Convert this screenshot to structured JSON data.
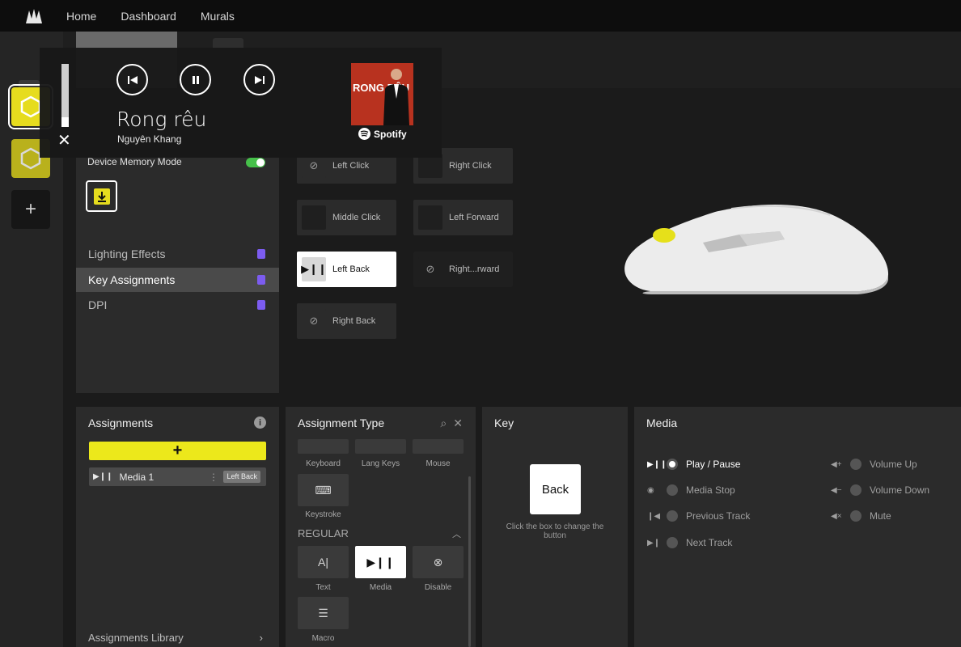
{
  "nav": {
    "home": "Home",
    "dashboard": "Dashboard",
    "murals": "Murals"
  },
  "device_settings": {
    "device_memory_mode_label": "Device Memory Mode",
    "device_memory_mode_on": true,
    "menu": [
      {
        "label": "Lighting Effects",
        "active": false
      },
      {
        "label": "Key Assignments",
        "active": true
      },
      {
        "label": "DPI",
        "active": false
      }
    ]
  },
  "keys": {
    "left_click": "Left Click",
    "right_click": "Right Click",
    "middle_click": "Middle Click",
    "left_forward": "Left Forward",
    "left_back": "Left Back",
    "right_forward": "Right...rward",
    "right_back": "Right Back"
  },
  "assignments": {
    "title": "Assignments",
    "add_label": "+",
    "item_label": "Media 1",
    "item_tag": "Left Back",
    "library": "Assignments Library"
  },
  "assignment_type": {
    "title": "Assignment Type",
    "advanced": [
      {
        "label": "Keyboard"
      },
      {
        "label": "Lang Keys"
      },
      {
        "label": "Mouse"
      },
      {
        "label": "Keystroke"
      }
    ],
    "section": "REGULAR",
    "regular": [
      {
        "label": "Text",
        "selected": false
      },
      {
        "label": "Media",
        "selected": true
      },
      {
        "label": "Disable",
        "selected": false
      },
      {
        "label": "Macro",
        "selected": false
      }
    ]
  },
  "key_panel": {
    "title": "Key",
    "key_value": "Back",
    "hint": "Click the box to change the button"
  },
  "media_panel": {
    "title": "Media",
    "options_left": [
      {
        "label": "Play / Pause",
        "selected": true
      },
      {
        "label": "Media Stop",
        "selected": false
      },
      {
        "label": "Previous Track",
        "selected": false
      },
      {
        "label": "Next Track",
        "selected": false
      }
    ],
    "options_right": [
      {
        "label": "Volume Up"
      },
      {
        "label": "Volume Down"
      },
      {
        "label": "Mute"
      }
    ]
  },
  "media_overlay": {
    "song": "Rong rêu",
    "artist": "Nguyên Khang",
    "album_art_text": "RONG RÊU",
    "service": "Spotify",
    "volume_fraction": 0.15
  },
  "colors": {
    "accent_yellow": "#ece81b",
    "toggle_green": "#46c04a",
    "lock_purple": "#7c5cf0"
  }
}
